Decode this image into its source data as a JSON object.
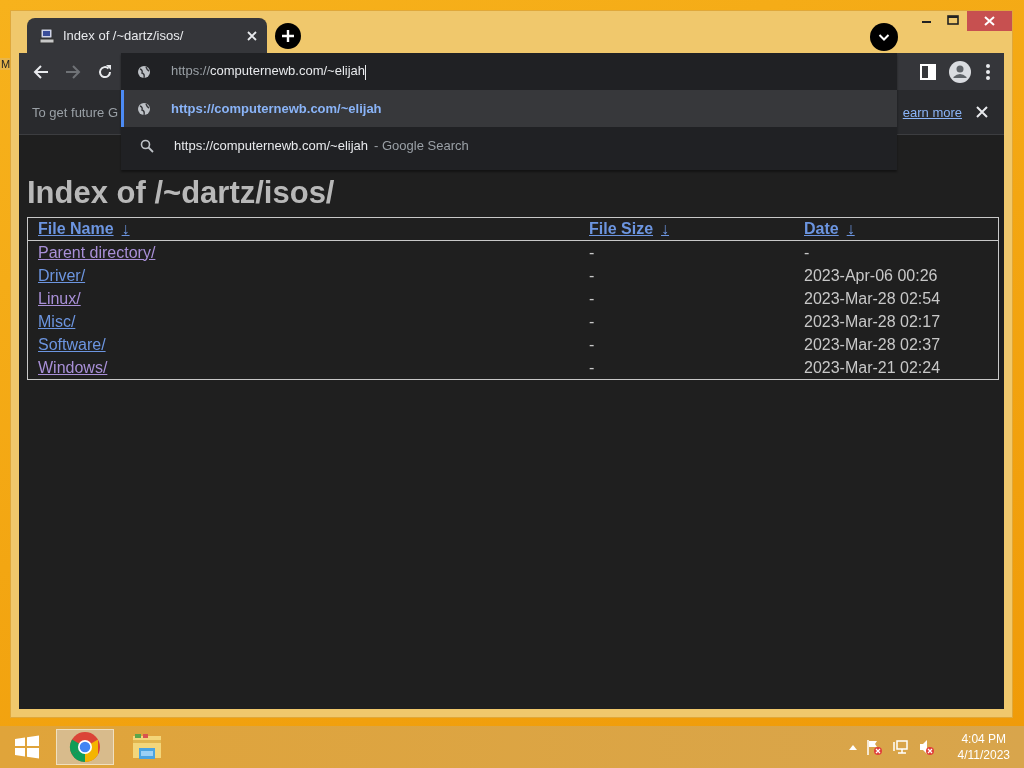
{
  "desktop": {
    "icon_label": "M"
  },
  "window": {
    "tabs": [
      {
        "title": "Index of /~dartz/isos/",
        "selected": true
      }
    ]
  },
  "toolbar": {
    "back_disabled": false,
    "forward_disabled": true
  },
  "omnibox": {
    "scheme": "https://",
    "rest": "computernewb.com/~elijah",
    "suggestions": [
      {
        "kind": "url",
        "text": "https://computernewb.com/~elijah",
        "selected": true
      },
      {
        "kind": "search",
        "text": "https://computernewb.com/~elijah",
        "suffix": "- Google Search",
        "selected": false
      }
    ]
  },
  "infobar": {
    "text": "To get future G",
    "link": "earn more"
  },
  "page": {
    "heading": "Index of /~dartz/isos/",
    "columns": [
      {
        "label": "File Name",
        "sort_mark": "↓"
      },
      {
        "label": "File Size",
        "sort_mark": "↓"
      },
      {
        "label": "Date",
        "sort_mark": "↓"
      }
    ],
    "rows": [
      {
        "name": "Parent directory/",
        "visited": true,
        "size": "-",
        "date": "-"
      },
      {
        "name": "Driver/",
        "visited": false,
        "size": "-",
        "date": "2023-Apr-06 00:26"
      },
      {
        "name": "Linux/",
        "visited": true,
        "size": "-",
        "date": "2023-Mar-28 02:54"
      },
      {
        "name": "Misc/",
        "visited": false,
        "size": "-",
        "date": "2023-Mar-28 02:17"
      },
      {
        "name": "Software/",
        "visited": false,
        "size": "-",
        "date": "2023-Mar-28 02:37"
      },
      {
        "name": "Windows/",
        "visited": true,
        "size": "-",
        "date": "2023-Mar-21 02:24"
      }
    ]
  },
  "taskbar": {
    "apps": [
      {
        "kind": "start"
      },
      {
        "kind": "chrome",
        "selected": true
      },
      {
        "kind": "explorer",
        "selected": false
      }
    ],
    "tray": [
      {
        "kind": "caret"
      },
      {
        "kind": "flag"
      },
      {
        "kind": "network"
      },
      {
        "kind": "speaker"
      }
    ],
    "time": "4:04 PM",
    "date": "4/11/2023"
  }
}
